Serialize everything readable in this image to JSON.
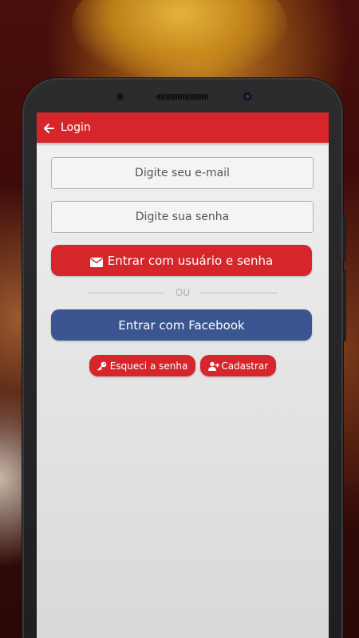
{
  "appbar": {
    "title": "Login",
    "back_icon": "arrow-left-icon",
    "color": "#d7262b"
  },
  "form": {
    "email_placeholder": "Digite seu e-mail",
    "email_value": "",
    "password_placeholder": "Digite sua senha",
    "password_value": "",
    "login_button_label": "Entrar com usuário e senha",
    "login_button_icon": "envelope-icon",
    "divider_text": "OU",
    "facebook_button_label": "Entrar com Facebook",
    "facebook_color": "#3b5591",
    "forgot_button_label": "Esqueci a senha",
    "forgot_button_icon": "key-icon",
    "register_button_label": "Cadastrar",
    "register_button_icon": "user-plus-icon"
  }
}
